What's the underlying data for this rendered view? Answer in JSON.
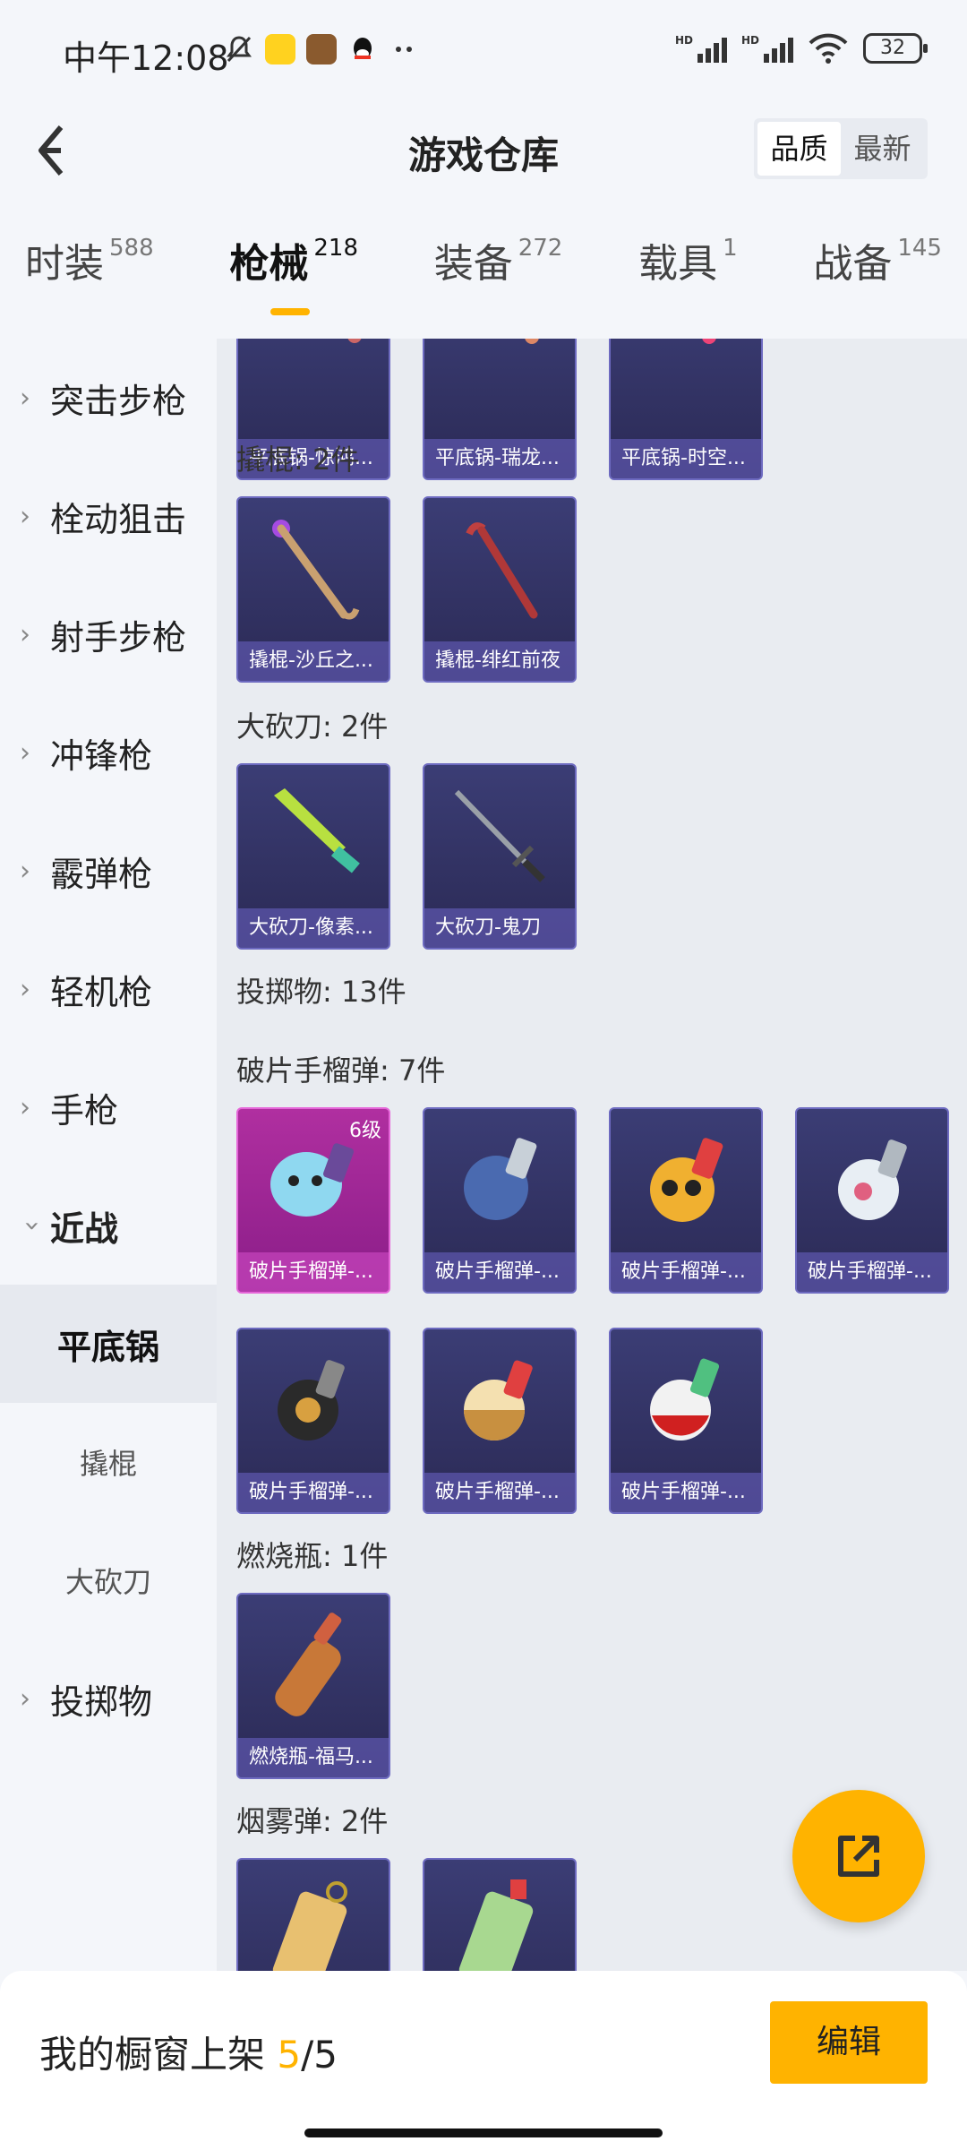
{
  "status_bar": {
    "time": "中午12:08",
    "battery": "32",
    "hd1": "HD",
    "hd2": "HD"
  },
  "header": {
    "title": "游戏仓库",
    "sort_options": [
      "品质",
      "最新"
    ],
    "active_sort": "品质"
  },
  "tabs": [
    {
      "label": "时装",
      "count": "588"
    },
    {
      "label": "枪械",
      "count": "218"
    },
    {
      "label": "装备",
      "count": "272"
    },
    {
      "label": "载具",
      "count": "1"
    },
    {
      "label": "战备",
      "count": "145"
    }
  ],
  "active_tab": "枪械",
  "sidebar": {
    "items": [
      {
        "label": "突击步枪"
      },
      {
        "label": "栓动狙击"
      },
      {
        "label": "射手步枪"
      },
      {
        "label": "冲锋枪"
      },
      {
        "label": "霰弹枪"
      },
      {
        "label": "轻机枪"
      },
      {
        "label": "手枪"
      },
      {
        "label": "近战"
      },
      {
        "label": "投掷物"
      }
    ],
    "sub_items": [
      {
        "label": "平底锅"
      },
      {
        "label": "撬棍"
      },
      {
        "label": "大砍刀"
      }
    ],
    "active_sub": "平底锅"
  },
  "content": {
    "pan_items": [
      "平底锅-惊鸿...",
      "平底锅-瑞龙...",
      "平底锅-时空..."
    ],
    "crowbar": {
      "title": "撬棍: 2件",
      "items": [
        "撬棍-沙丘之...",
        "撬棍-绯红前夜"
      ]
    },
    "machete": {
      "title": "大砍刀: 2件",
      "items": [
        "大砍刀-像素...",
        "大砍刀-鬼刀"
      ]
    },
    "throwables_title": "投掷物: 13件",
    "frag": {
      "title": "破片手榴弹: 7件",
      "items": [
        "破片手榴弹-...",
        "破片手榴弹-...",
        "破片手榴弹-...",
        "破片手榴弹-...",
        "破片手榴弹-...",
        "破片手榴弹-...",
        "破片手榴弹-..."
      ],
      "first_badge": "6级"
    },
    "molotov": {
      "title": "燃烧瓶: 1件",
      "items": [
        "燃烧瓶-福马..."
      ]
    },
    "smoke": {
      "title": "烟雾弹: 2件"
    }
  },
  "bottom_bar": {
    "label": "我的橱窗上架",
    "count_current": "5",
    "count_total": "/5",
    "edit_label": "编辑"
  },
  "colors": {
    "accent": "#ffb300",
    "card_purple": "#3b3d75",
    "card_pink": "#b02fa0"
  }
}
